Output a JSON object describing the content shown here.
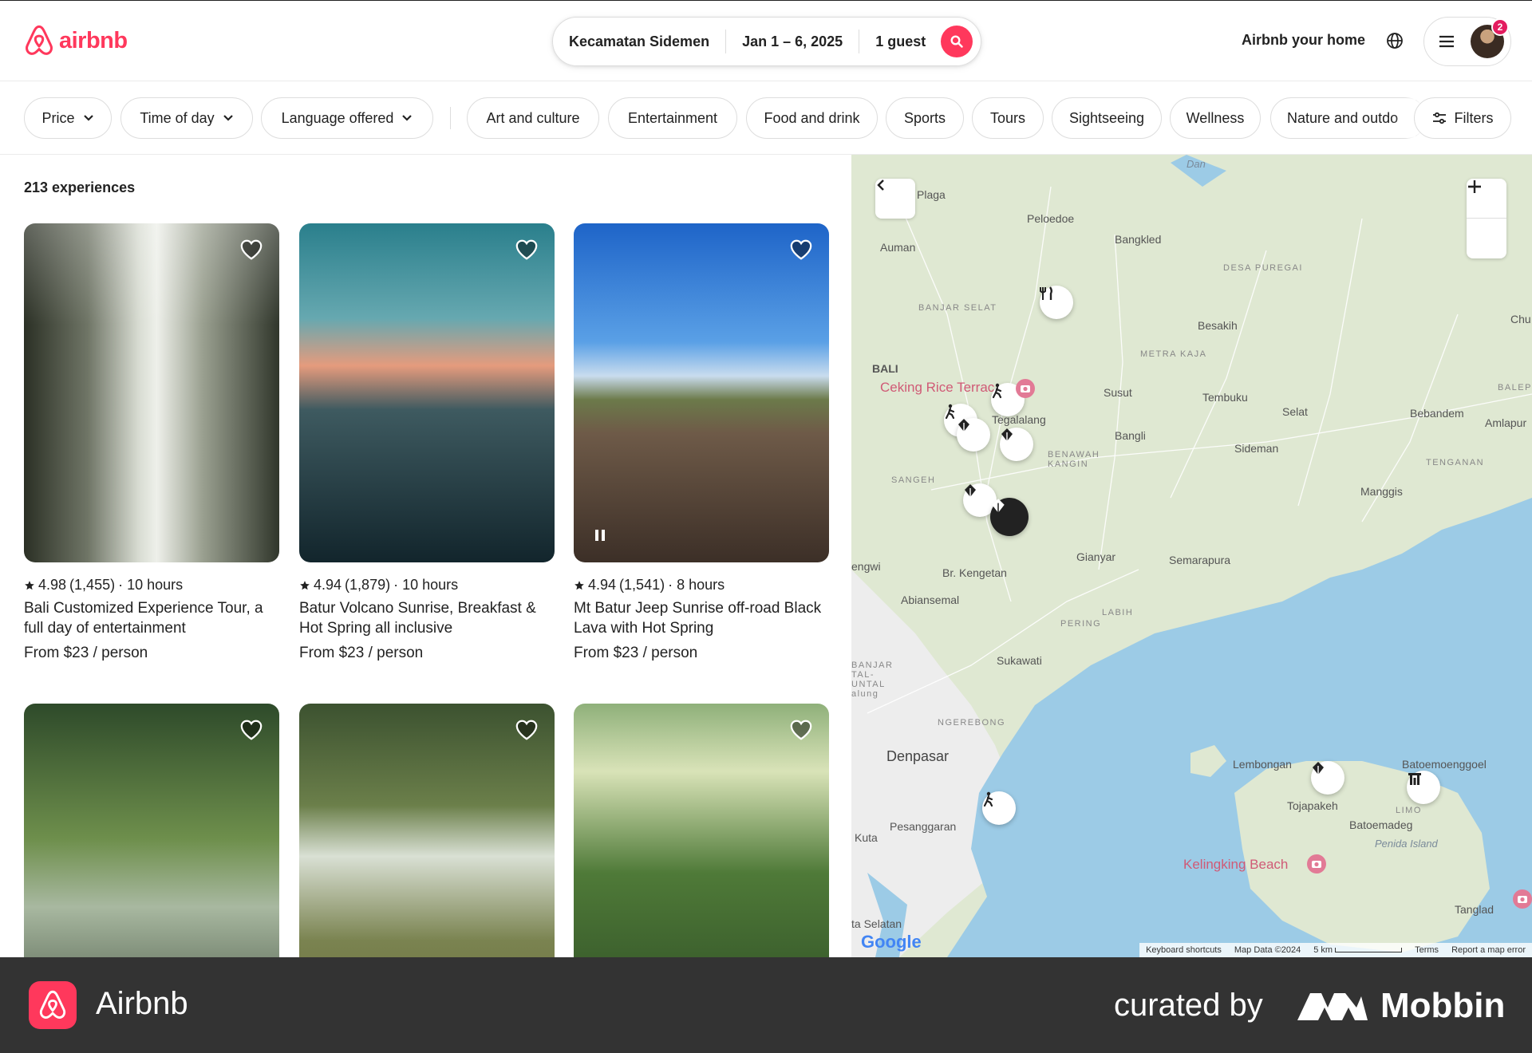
{
  "header": {
    "logo_text": "airbnb",
    "search": {
      "location": "Kecamatan Sidemen",
      "dates": "Jan 1 – 6, 2025",
      "guests": "1 guest"
    },
    "host_link": "Airbnb your home",
    "notification_count": "2"
  },
  "filters": {
    "dropdowns": [
      "Price",
      "Time of day",
      "Language offered"
    ],
    "categories": [
      "Art and culture",
      "Entertainment",
      "Food and drink",
      "Sports",
      "Tours",
      "Sightseeing",
      "Wellness",
      "Nature and outdo"
    ],
    "filters_label": "Filters"
  },
  "results": {
    "count_label": "213 experiences",
    "listings": [
      {
        "rating": "4.98",
        "reviews": "(1,455)",
        "duration": "· 10 hours",
        "title": "Bali Customized Experience Tour, a full day of entertainment",
        "price": "From $23 / person"
      },
      {
        "rating": "4.94",
        "reviews": "(1,879)",
        "duration": "· 10 hours",
        "title": "Batur Volcano Sunrise, Breakfast & Hot Spring all inclusive",
        "price": "From $23 / person"
      },
      {
        "rating": "4.94",
        "reviews": "(1,541)",
        "duration": "· 8 hours",
        "title": "Mt Batur Jeep Sunrise off-road Black Lava with Hot Spring",
        "price": "From $23 / person"
      }
    ]
  },
  "map": {
    "labels": {
      "plaga": "Plaga",
      "peloedoe": "Peloedoe",
      "bangkled": "Bangkled",
      "auman": "Auman",
      "desa_puregai": "DESA PUREGAI",
      "banjar_selat": "BANJAR SELAT",
      "besakih": "Besakih",
      "chu": "Chu",
      "metra_kaja": "METRA KAJA",
      "bali": "BALI",
      "ceking": "Ceking Rice Terrac",
      "susut": "Susut",
      "tembuku": "Tembuku",
      "bebandem": "Bebandem",
      "balep": "BALEP",
      "amlapur": "Amlapur",
      "tegalalang": "Tegalalang",
      "selat": "Selat",
      "bangli": "Bangli",
      "benawah": "BENAWAH KANGIN",
      "sideman": "Sideman",
      "tenganan": "TENGANAN",
      "sangeh": "SANGEH",
      "manggis": "Manggis",
      "gianyar": "Gianyar",
      "semarapura": "Semarapura",
      "engwi": "engwi",
      "kengetan": "Br. Kengetan",
      "abiansemal": "Abiansemal",
      "labih": "LABIH",
      "pering": "PERING",
      "sukawati": "Sukawati",
      "banjar_tal": "BANJAR TAL-UNTAL alung",
      "ngerebong": "NGEREBONG",
      "denpasar": "Denpasar",
      "lembongan": "Lembongan",
      "batoemoenggoel": "Batoemoenggoel",
      "tojapakeh": "Tojapakeh",
      "limo": "LIMO",
      "batoemadeg": "Batoemadeg",
      "penida": "Penida Island",
      "pesanggaran": "Pesanggaran",
      "kuta": "Kuta",
      "kelingking": "Kelingking Beach",
      "tanglad": "Tanglad",
      "selatan": "ta Selatan",
      "dan": "Dan"
    },
    "footer": {
      "shortcuts": "Keyboard shortcuts",
      "data": "Map Data ©2024",
      "scale": "5 km",
      "terms": "Terms",
      "report": "Report a map error"
    },
    "google": "Google"
  },
  "bottombar": {
    "app_name": "Airbnb",
    "curated": "curated by",
    "brand": "Mobbin"
  },
  "colors": {
    "brand": "#ff385c",
    "water": "#9ccbe6",
    "land": "#dfe8d2"
  }
}
